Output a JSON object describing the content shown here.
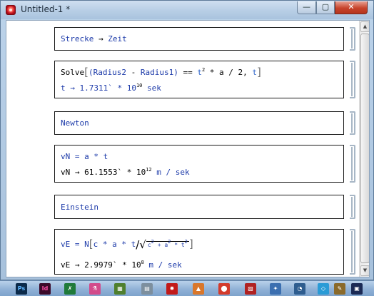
{
  "window": {
    "title": "Untitled-1 *",
    "controls": {
      "minimize": "—",
      "maximize": "▢",
      "close": "✕"
    }
  },
  "cells": [
    {
      "lines": [
        {
          "parts": [
            "Strecke",
            " → ",
            "Zeit"
          ]
        }
      ]
    },
    {
      "lines": [
        {
          "parts": [
            "Solve",
            "[",
            "(Radius2",
            " - ",
            "Radius1)",
            " == ",
            "t",
            "2",
            " * a / 2, ",
            "t",
            "]"
          ]
        },
        {
          "parts": [
            "t → 1.7311` * 10",
            "10",
            " sek"
          ]
        }
      ]
    },
    {
      "lines": [
        {
          "parts": [
            "Newton"
          ]
        }
      ]
    },
    {
      "lines": [
        {
          "parts": [
            "vN = a * t"
          ]
        },
        {
          "parts": [
            "vN → 61.1553` * 10",
            "12",
            " m / sek"
          ]
        }
      ]
    },
    {
      "lines": [
        {
          "parts": [
            "Einstein"
          ]
        }
      ]
    },
    {
      "lines": [
        {
          "parts": [
            "vE = N",
            "[",
            "c * a * t",
            "/",
            "√",
            "c",
            "2",
            " + a",
            "2",
            " * t",
            "2",
            "]"
          ]
        },
        {
          "parts": [
            "vE → 2.9979` * 10",
            "8",
            " m / sek"
          ]
        }
      ]
    }
  ],
  "taskbar": {
    "items": [
      "Ps",
      "Id",
      "✗",
      "⚗",
      "▦",
      "▤",
      "✹",
      "▲",
      "⬤",
      "▧",
      "✦",
      "◔",
      "◇",
      "✎",
      "▣"
    ]
  }
}
